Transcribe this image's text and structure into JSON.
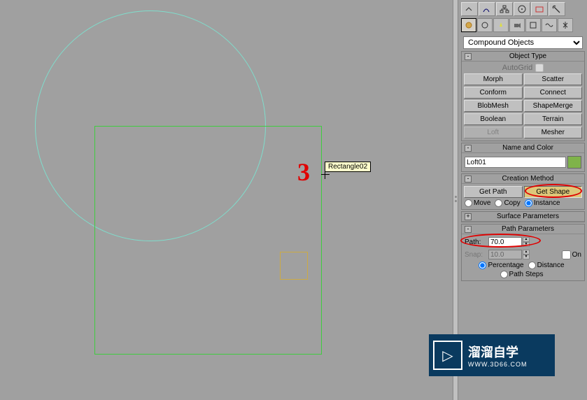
{
  "viewport": {
    "tooltip": "Rectangle02",
    "annotation": "3"
  },
  "dropdown": {
    "selected": "Compound Objects"
  },
  "objectType": {
    "header": "Object Type",
    "toggle": "-",
    "autogrid": "AutoGrid",
    "buttons": [
      "Morph",
      "Scatter",
      "Conform",
      "Connect",
      "BlobMesh",
      "ShapeMerge",
      "Boolean",
      "Terrain",
      "Loft",
      "Mesher"
    ]
  },
  "nameColor": {
    "header": "Name and Color",
    "toggle": "-",
    "name_value": "Loft01"
  },
  "creationMethod": {
    "header": "Creation Method",
    "toggle": "-",
    "get_path": "Get Path",
    "get_shape": "Get Shape",
    "move": "Move",
    "copy": "Copy",
    "instance": "Instance"
  },
  "surfaceParams": {
    "header": "Surface Parameters",
    "toggle": "+"
  },
  "pathParams": {
    "header": "Path Parameters",
    "toggle": "-",
    "path_label": "Path:",
    "path_value": "70.0",
    "snap_label": "Snap:",
    "snap_value": "10.0",
    "on": "On",
    "percentage": "Percentage",
    "distance": "Distance",
    "path_steps": "Path Steps"
  },
  "watermark": {
    "line1": "溜溜自学",
    "line2": "WWW.3D66.COM"
  }
}
